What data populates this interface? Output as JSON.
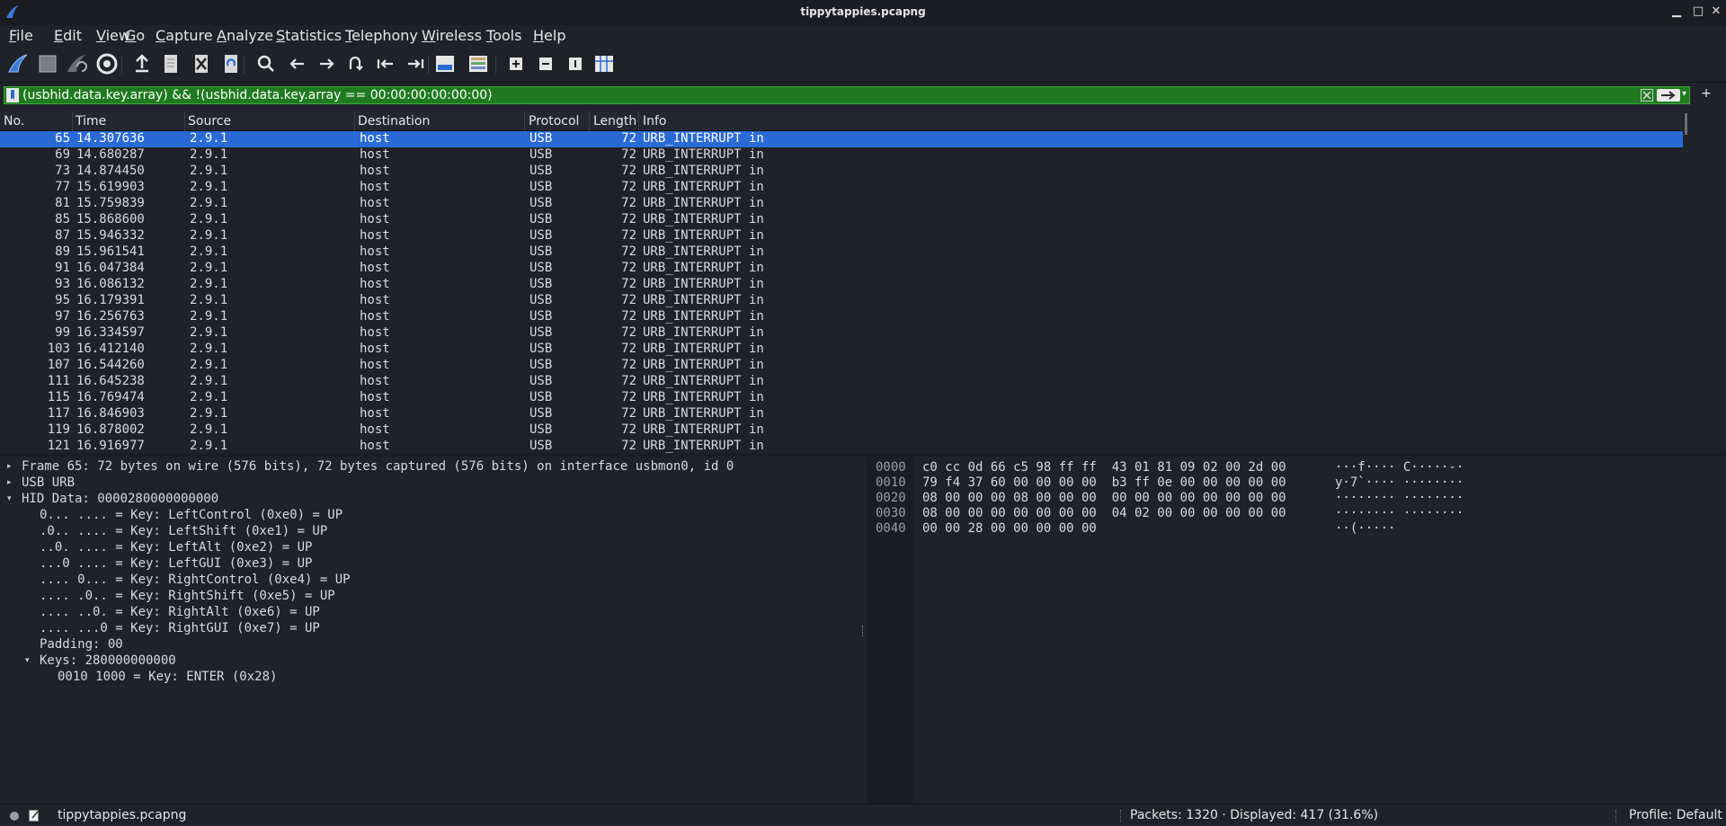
{
  "window": {
    "title": "tippytappies.pcapng",
    "minimize": "▁",
    "maximize": "□",
    "close": "✕"
  },
  "menu": [
    {
      "label": "File",
      "key": "F",
      "rest": "ile"
    },
    {
      "label": "Edit",
      "key": "E",
      "rest": "dit"
    },
    {
      "label": "View",
      "key": "V",
      "rest": "iew"
    },
    {
      "label": "Go",
      "key": "G",
      "rest": "o"
    },
    {
      "label": "Capture",
      "key": "C",
      "rest": "apture"
    },
    {
      "label": "Analyze",
      "key": "A",
      "rest": "nalyze"
    },
    {
      "label": "Statistics",
      "key": "S",
      "rest": "tatistics"
    },
    {
      "label": "Telephony",
      "key": "T",
      "rest": "elephony"
    },
    {
      "label": "Wireless",
      "key": "W",
      "rest": "ireless"
    },
    {
      "label": "Tools",
      "key": "T",
      "rest": "ools"
    },
    {
      "label": "Help",
      "key": "H",
      "rest": "elp"
    }
  ],
  "toolbar": [
    "start-capture-icon",
    "stop-capture-icon",
    "restart-capture-icon",
    "capture-options-icon",
    "open-file-icon",
    "file-icon",
    "close-file-icon",
    "reload-file-icon",
    "find-packet-icon",
    "go-back-icon",
    "go-forward-icon",
    "go-to-packet-icon",
    "first-packet-icon",
    "last-packet-icon",
    "autoscroll-icon",
    "colorize-icon",
    "zoom-in-icon",
    "zoom-out-icon",
    "normal-size-icon",
    "resize-columns-icon"
  ],
  "filter": {
    "text": "(usbhid.data.key.array) && !(usbhid.data.key.array == 00:00:00:00:00:00)",
    "add_button": "+"
  },
  "columns": [
    "No.",
    "Time",
    "Source",
    "Destination",
    "Protocol",
    "Length",
    "Info"
  ],
  "packets": [
    {
      "no": "65",
      "time": "14.307636",
      "src": "2.9.1",
      "dst": "host",
      "proto": "USB",
      "len": "72",
      "info": "URB_INTERRUPT in",
      "selected": true
    },
    {
      "no": "69",
      "time": "14.680287",
      "src": "2.9.1",
      "dst": "host",
      "proto": "USB",
      "len": "72",
      "info": "URB_INTERRUPT in"
    },
    {
      "no": "73",
      "time": "14.874450",
      "src": "2.9.1",
      "dst": "host",
      "proto": "USB",
      "len": "72",
      "info": "URB_INTERRUPT in"
    },
    {
      "no": "77",
      "time": "15.619903",
      "src": "2.9.1",
      "dst": "host",
      "proto": "USB",
      "len": "72",
      "info": "URB_INTERRUPT in"
    },
    {
      "no": "81",
      "time": "15.759839",
      "src": "2.9.1",
      "dst": "host",
      "proto": "USB",
      "len": "72",
      "info": "URB_INTERRUPT in"
    },
    {
      "no": "85",
      "time": "15.868600",
      "src": "2.9.1",
      "dst": "host",
      "proto": "USB",
      "len": "72",
      "info": "URB_INTERRUPT in"
    },
    {
      "no": "87",
      "time": "15.946332",
      "src": "2.9.1",
      "dst": "host",
      "proto": "USB",
      "len": "72",
      "info": "URB_INTERRUPT in"
    },
    {
      "no": "89",
      "time": "15.961541",
      "src": "2.9.1",
      "dst": "host",
      "proto": "USB",
      "len": "72",
      "info": "URB_INTERRUPT in"
    },
    {
      "no": "91",
      "time": "16.047384",
      "src": "2.9.1",
      "dst": "host",
      "proto": "USB",
      "len": "72",
      "info": "URB_INTERRUPT in"
    },
    {
      "no": "93",
      "time": "16.086132",
      "src": "2.9.1",
      "dst": "host",
      "proto": "USB",
      "len": "72",
      "info": "URB_INTERRUPT in"
    },
    {
      "no": "95",
      "time": "16.179391",
      "src": "2.9.1",
      "dst": "host",
      "proto": "USB",
      "len": "72",
      "info": "URB_INTERRUPT in"
    },
    {
      "no": "97",
      "time": "16.256763",
      "src": "2.9.1",
      "dst": "host",
      "proto": "USB",
      "len": "72",
      "info": "URB_INTERRUPT in"
    },
    {
      "no": "99",
      "time": "16.334597",
      "src": "2.9.1",
      "dst": "host",
      "proto": "USB",
      "len": "72",
      "info": "URB_INTERRUPT in"
    },
    {
      "no": "103",
      "time": "16.412140",
      "src": "2.9.1",
      "dst": "host",
      "proto": "USB",
      "len": "72",
      "info": "URB_INTERRUPT in"
    },
    {
      "no": "107",
      "time": "16.544260",
      "src": "2.9.1",
      "dst": "host",
      "proto": "USB",
      "len": "72",
      "info": "URB_INTERRUPT in"
    },
    {
      "no": "111",
      "time": "16.645238",
      "src": "2.9.1",
      "dst": "host",
      "proto": "USB",
      "len": "72",
      "info": "URB_INTERRUPT in"
    },
    {
      "no": "115",
      "time": "16.769474",
      "src": "2.9.1",
      "dst": "host",
      "proto": "USB",
      "len": "72",
      "info": "URB_INTERRUPT in"
    },
    {
      "no": "117",
      "time": "16.846903",
      "src": "2.9.1",
      "dst": "host",
      "proto": "USB",
      "len": "72",
      "info": "URB_INTERRUPT in"
    },
    {
      "no": "119",
      "time": "16.878002",
      "src": "2.9.1",
      "dst": "host",
      "proto": "USB",
      "len": "72",
      "info": "URB_INTERRUPT in"
    },
    {
      "no": "121",
      "time": "16.916977",
      "src": "2.9.1",
      "dst": "host",
      "proto": "USB",
      "len": "72",
      "info": "URB_INTERRUPT in"
    }
  ],
  "details": [
    {
      "text": "Frame 65: 72 bytes on wire (576 bits), 72 bytes captured (576 bits) on interface usbmon0, id 0",
      "indent": 0,
      "expander": "collapsed"
    },
    {
      "text": "USB URB",
      "indent": 0,
      "expander": "collapsed"
    },
    {
      "text": "HID Data: 0000280000000000",
      "indent": 0,
      "expander": "expanded"
    },
    {
      "text": "0... .... = Key: LeftControl (0xe0) = UP",
      "indent": 1,
      "expander": "none"
    },
    {
      "text": ".0.. .... = Key: LeftShift (0xe1) = UP",
      "indent": 1,
      "expander": "none"
    },
    {
      "text": "..0. .... = Key: LeftAlt (0xe2) = UP",
      "indent": 1,
      "expander": "none"
    },
    {
      "text": "...0 .... = Key: LeftGUI (0xe3) = UP",
      "indent": 1,
      "expander": "none"
    },
    {
      "text": ".... 0... = Key: RightControl (0xe4) = UP",
      "indent": 1,
      "expander": "none"
    },
    {
      "text": ".... .0.. = Key: RightShift (0xe5) = UP",
      "indent": 1,
      "expander": "none"
    },
    {
      "text": ".... ..0. = Key: RightAlt (0xe6) = UP",
      "indent": 1,
      "expander": "none"
    },
    {
      "text": ".... ...0 = Key: RightGUI (0xe7) = UP",
      "indent": 1,
      "expander": "none"
    },
    {
      "text": "Padding: 00",
      "indent": 1,
      "expander": "none"
    },
    {
      "text": "Keys: 280000000000",
      "indent": 1,
      "expander": "expanded"
    },
    {
      "text": "0010 1000 = Key: ENTER (0x28)",
      "indent": 2,
      "expander": "none"
    }
  ],
  "bytes": [
    {
      "offset": "0000",
      "hex": "c0 cc 0d 66 c5 98 ff ff  43 01 81 09 02 00 2d 00",
      "ascii": "···f···· C·····-·"
    },
    {
      "offset": "0010",
      "hex": "79 f4 37 60 00 00 00 00  b3 ff 0e 00 00 00 00 00",
      "ascii": "y·7`···· ········"
    },
    {
      "offset": "0020",
      "hex": "08 00 00 00 08 00 00 00  00 00 00 00 00 00 00 00",
      "ascii": "········ ········"
    },
    {
      "offset": "0030",
      "hex": "08 00 00 00 00 00 00 00  04 02 00 00 00 00 00 00",
      "ascii": "········ ········"
    },
    {
      "offset": "0040",
      "hex": "00 00 28 00 00 00 00 00",
      "ascii": "··(·····"
    }
  ],
  "status": {
    "file": "tippytappies.pcapng",
    "packets": "Packets: 1320 · Displayed: 417 (31.6%)",
    "profile": "Profile: Default"
  },
  "colors": {
    "selection": "#2a6ad6",
    "filter_valid": "#1f7a1f",
    "background": "#1f2228"
  }
}
